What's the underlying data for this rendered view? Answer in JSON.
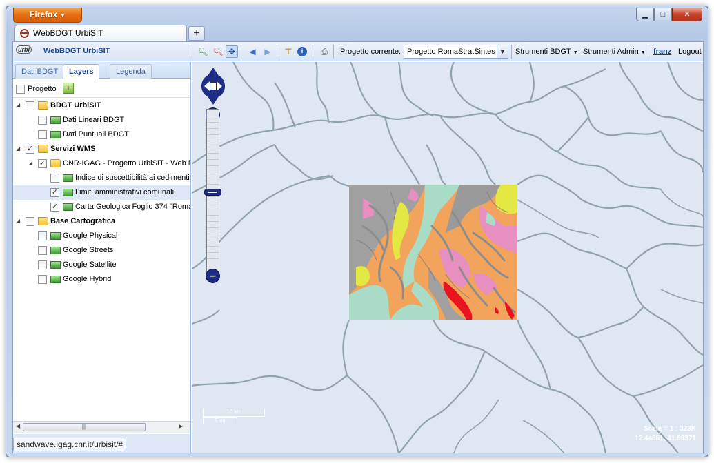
{
  "browser": {
    "menu_button": "Firefox",
    "tab_title": "WebBDGT UrbiSIT",
    "new_tab": "+",
    "window_controls": {
      "minimize": "▁",
      "maximize": "□",
      "close": "✕"
    },
    "status_url": "sandwave.igag.cnr.it/urbisit/#"
  },
  "toolbar": {
    "logo_text": "urbi",
    "app_title": "WebBDGT UrbiSIT",
    "project_label": "Progetto corrente:",
    "project_value": "Progetto RomaStratSintes",
    "menu_bdgt": "Strumenti BDGT",
    "menu_admin": "Strumenti Admin",
    "user": "franz",
    "logout": "Logout"
  },
  "panel": {
    "tabs": [
      "Dati BDGT",
      "Layers",
      "Legenda"
    ],
    "active_tab": "Layers",
    "project_checkbox_label": "Progetto",
    "tree": [
      {
        "label": "BDGT UrbiSIT",
        "type": "folder",
        "level": 0,
        "expanded": true,
        "checked": false,
        "bold": true
      },
      {
        "label": "Dati Lineari BDGT",
        "type": "layer",
        "level": 1,
        "checked": false
      },
      {
        "label": "Dati Puntuali BDGT",
        "type": "layer",
        "level": 1,
        "checked": false
      },
      {
        "label": "Servizi WMS",
        "type": "folder",
        "level": 0,
        "expanded": true,
        "checked": true,
        "bold": true
      },
      {
        "label": "CNR-IGAG - Progetto UrbiSIT - Web M",
        "type": "folder",
        "level": 1,
        "expanded": true,
        "checked": true
      },
      {
        "label": "Indice di suscettibilità ai cedimenti",
        "type": "layer",
        "level": 2,
        "checked": false
      },
      {
        "label": "Limiti amministrativi comunali",
        "type": "layer",
        "level": 2,
        "checked": true,
        "selected": true
      },
      {
        "label": "Carta Geologica Foglio 374 \"Roma",
        "type": "layer",
        "level": 2,
        "checked": true
      },
      {
        "label": "Base Cartografica",
        "type": "folder",
        "level": 0,
        "expanded": true,
        "checked": false,
        "bold": true
      },
      {
        "label": "Google Physical",
        "type": "layer",
        "level": 1,
        "checked": false
      },
      {
        "label": "Google Streets",
        "type": "layer",
        "level": 1,
        "checked": false
      },
      {
        "label": "Google Satellite",
        "type": "layer",
        "level": 1,
        "checked": false
      },
      {
        "label": "Google Hybrid",
        "type": "layer",
        "level": 1,
        "checked": false
      }
    ]
  },
  "map": {
    "scale_km": "10 km",
    "scale_mi": "5 mi",
    "scale_text": "Scale = 1 : 323K",
    "coords": "12.44851, 41.89371",
    "colors": {
      "background": "#dfe7f3",
      "boundaries": "#8ea3ab",
      "geology_base": "#f2a45c",
      "geology_gray": "#9a9a9a",
      "geology_pink": "#e68fc0",
      "geology_teal": "#a9dcc6",
      "geology_yellow": "#e3e843",
      "geology_red": "#e8141e"
    }
  }
}
